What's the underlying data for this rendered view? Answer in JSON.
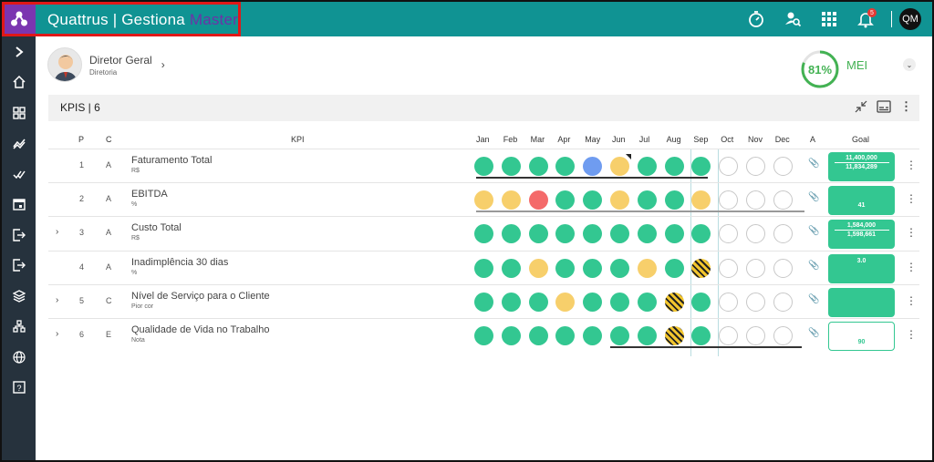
{
  "app": {
    "brand_main": "Quattrus | Gestiona",
    "brand_accent": "Master",
    "notification_count": "5",
    "user_initials": "QM"
  },
  "colors": {
    "topbar": "#109393",
    "logo_bg": "#7b35b0",
    "sidebar": "#26323d",
    "green": "#33c791",
    "yellow": "#f7cf6b",
    "red": "#f46a6a",
    "blue": "#6f9cf0",
    "highlight": "#e01818"
  },
  "topbar_icons": [
    "timer-icon",
    "user-search-icon",
    "apps-grid-icon",
    "notifications-bell-icon"
  ],
  "sidebar_icons": [
    "expand-chevron-icon",
    "home-icon",
    "dashboard-icon",
    "trending-icon",
    "double-check-icon",
    "calendar-icon",
    "exit-icon",
    "exit-icon",
    "layers-icon",
    "hierarchy-icon",
    "globe-icon",
    "help-icon"
  ],
  "user": {
    "name": "Diretor Geral",
    "role": "Diretoria"
  },
  "score": {
    "value": "81%",
    "label": "MEI",
    "fraction": 0.81
  },
  "kpis": {
    "title": "KPIS | 6",
    "columns": {
      "p": "P",
      "c": "C",
      "kpi": "KPI",
      "a": "A",
      "goal": "Goal"
    },
    "months": [
      "Jan",
      "Feb",
      "Mar",
      "Apr",
      "May",
      "Jun",
      "Jul",
      "Aug",
      "Sep",
      "Oct",
      "Nov",
      "Dec"
    ],
    "rows": [
      {
        "p": "1",
        "c": "A",
        "name": "Faturamento Total",
        "unit": "R$",
        "expandable": false,
        "statuses": [
          "green",
          "green",
          "green",
          "green",
          "blue",
          "yellow",
          "green",
          "green",
          "green",
          "empty",
          "empty",
          "empty"
        ],
        "goal_top": "11,400,000",
        "goal_bottom": "11,834,289",
        "goal_style": "split",
        "attachment": true
      },
      {
        "p": "2",
        "c": "A",
        "name": "EBITDA",
        "unit": "%",
        "expandable": false,
        "statuses": [
          "yellow",
          "yellow",
          "red",
          "green",
          "green",
          "yellow",
          "green",
          "green",
          "yellow",
          "empty",
          "empty",
          "empty"
        ],
        "goal_top": "",
        "goal_bottom": "41",
        "goal_style": "single-bottom",
        "attachment": true
      },
      {
        "p": "3",
        "c": "A",
        "name": "Custo Total",
        "unit": "R$",
        "expandable": true,
        "statuses": [
          "green",
          "green",
          "green",
          "green",
          "green",
          "green",
          "green",
          "green",
          "green",
          "empty",
          "empty",
          "empty"
        ],
        "goal_top": "1,584,000",
        "goal_bottom": "1,598,661",
        "goal_style": "split",
        "attachment": false
      },
      {
        "p": "4",
        "c": "A",
        "name": "Inadimplência 30 dias",
        "unit": "%",
        "expandable": false,
        "statuses": [
          "green",
          "green",
          "yellow",
          "green",
          "green",
          "green",
          "yellow",
          "green",
          "stripe",
          "empty",
          "empty",
          "empty"
        ],
        "goal_top": "3.0",
        "goal_bottom": "",
        "goal_style": "single-top",
        "attachment": false
      },
      {
        "p": "5",
        "c": "C",
        "name": "Nível de Serviço para o Cliente",
        "unit": "Pior cor",
        "expandable": true,
        "statuses": [
          "green",
          "green",
          "green",
          "yellow",
          "green",
          "green",
          "green",
          "stripe",
          "green",
          "empty",
          "empty",
          "empty"
        ],
        "goal_top": "",
        "goal_bottom": "",
        "goal_style": "empty",
        "attachment": false
      },
      {
        "p": "6",
        "c": "E",
        "name": "Qualidade de Vida no Trabalho",
        "unit": "Nota",
        "expandable": true,
        "statuses": [
          "green",
          "green",
          "green",
          "green",
          "green",
          "green",
          "green",
          "stripe",
          "green",
          "empty",
          "empty",
          "empty"
        ],
        "goal_top": "",
        "goal_bottom": "90",
        "goal_style": "outline",
        "attachment": false
      }
    ]
  }
}
